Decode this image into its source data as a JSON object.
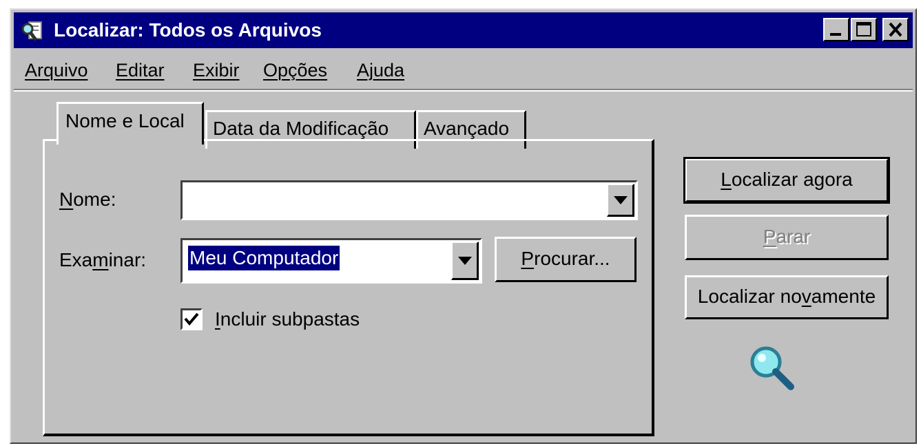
{
  "window": {
    "title": "Localizar: Todos os Arquivos",
    "icon": "find-files-icon",
    "controls": [
      "minimize-icon",
      "maximize-icon",
      "close-icon"
    ]
  },
  "menu": {
    "items": [
      {
        "label": "Arquivo",
        "accel": "A"
      },
      {
        "label": "Editar",
        "accel": "E"
      },
      {
        "label": "Exibir",
        "accel": "x"
      },
      {
        "label": "Opções",
        "accel": "O"
      },
      {
        "label": "Ajuda",
        "accel": "j"
      }
    ]
  },
  "tabs": [
    {
      "label": "Nome e Local",
      "active": true
    },
    {
      "label": "Data da Modificação",
      "active": false
    },
    {
      "label": "Avançado",
      "active": false
    }
  ],
  "form": {
    "name_label_accel": "N",
    "name_label_rest": "ome:",
    "name_value": "",
    "examine_label_pre": "Exa",
    "examine_label_accel": "m",
    "examine_label_post": "inar:",
    "examine_value": "Meu Computador",
    "browse_accel": "P",
    "browse_rest": "rocurar...",
    "include_subfolders_accel": "I",
    "include_subfolders_rest": "ncluir subpastas",
    "include_subfolders_checked": true
  },
  "actions": {
    "find_now_accel": "L",
    "find_now_rest": "ocalizar agora",
    "stop_accel": "P",
    "stop_rest": "arar",
    "stop_enabled": false,
    "new_search_pre": "Localizar no",
    "new_search_accel": "v",
    "new_search_post": "amente"
  },
  "colors": {
    "titlebar": "#000080",
    "face": "#c0c0c0",
    "selection": "#000080"
  },
  "decoration": {
    "icon": "magnifier-icon"
  }
}
